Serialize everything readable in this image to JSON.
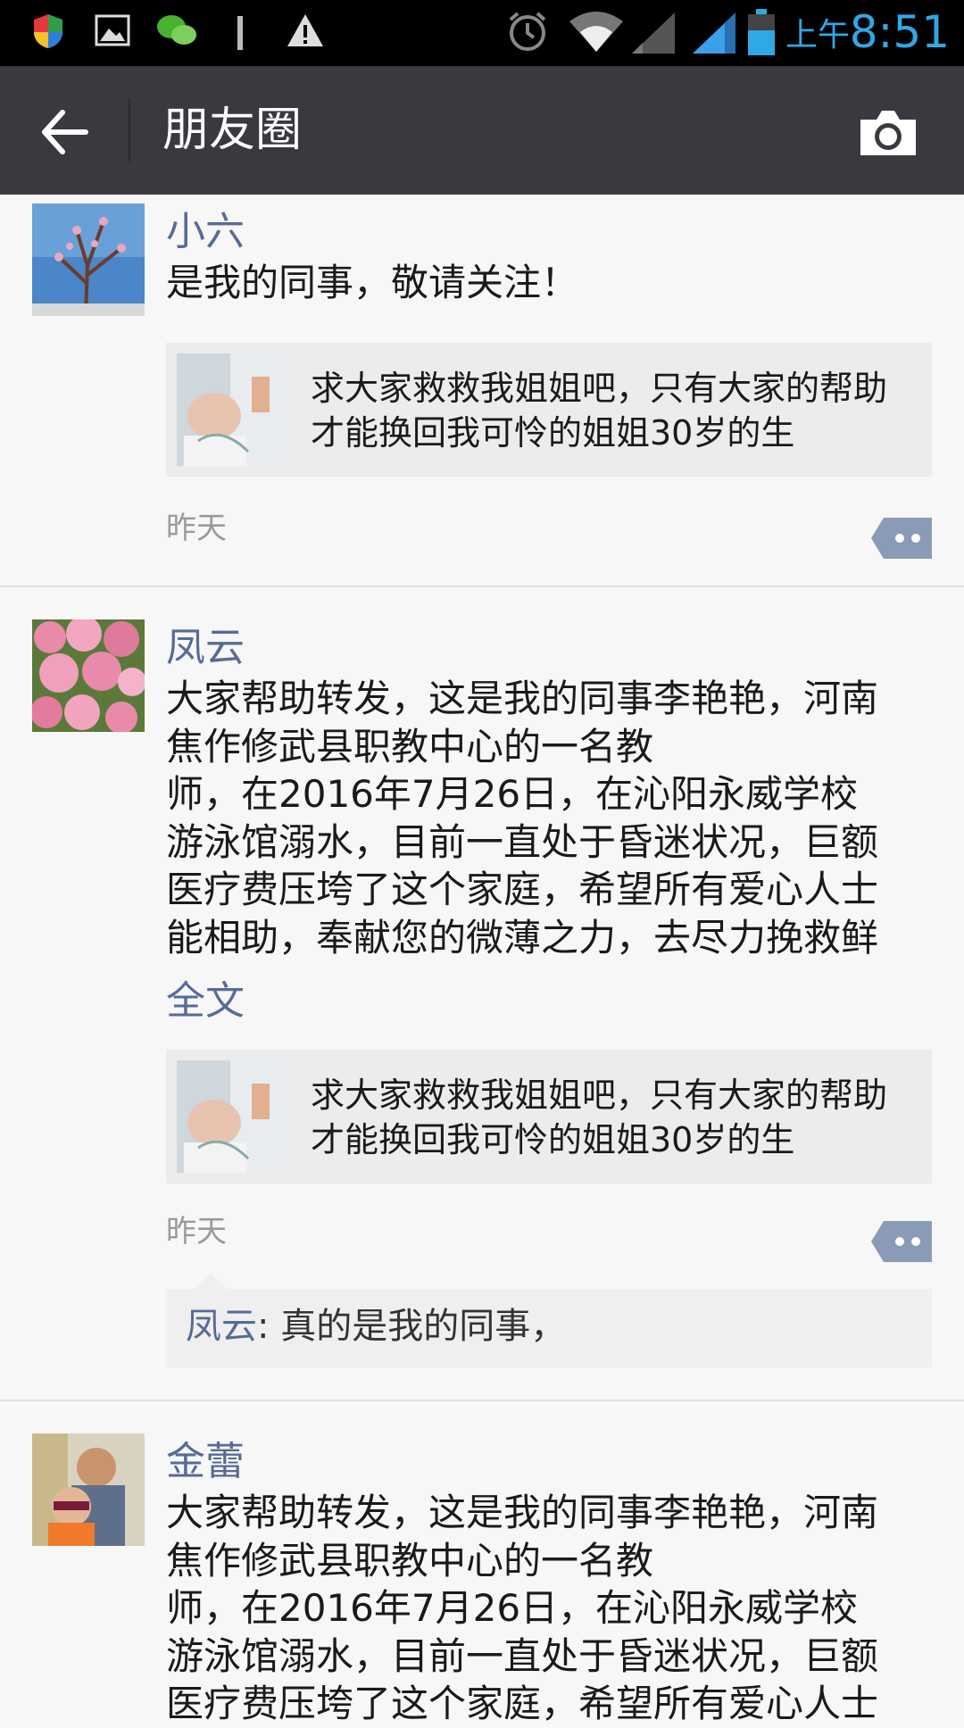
{
  "status_bar": {
    "ampm": "上午",
    "time": "8:51",
    "icons": [
      "shield-icon",
      "image-icon",
      "wechat-icon",
      "notification-bar-icon",
      "warning-icon",
      "alarm-icon",
      "wifi-icon",
      "signal-icon",
      "signal-icon",
      "battery-icon"
    ]
  },
  "nav": {
    "title": "朋友圈",
    "back_icon": "back-arrow-icon",
    "camera_icon": "camera-icon"
  },
  "posts": [
    {
      "name": "小六",
      "text": "是我的同事，敬请关注！",
      "share_text": "求大家救救我姐姐吧，只有大家的帮助才能换回我可怜的姐姐30岁的生",
      "time": "昨天"
    },
    {
      "name": "凤云",
      "text": "大家帮助转发，这是我的同事李艳艳，河南焦作修武县职教中心的一名教师，在2016年7月26日，在沁阳永威学校游泳馆溺水，目前一直处于昏迷状况，巨额医疗费压垮了这个家庭，希望所有爱心人士能相助，奉献您的微薄之力，去尽力挽救鲜",
      "text_lines": [
        "大家帮助转发，这是我的同事李艳艳，河南",
        "焦作修武县职教中心的一名教",
        "师，在2016年7月26日，在沁阳永威学校",
        "游泳馆溺水，目前一直处于昏迷状况，巨额",
        "医疗费压垮了这个家庭，希望所有爱心人士",
        "能相助，奉献您的微薄之力，去尽力挽救鲜"
      ],
      "full_text_link": "全文",
      "share_text": "求大家救救我姐姐吧，只有大家的帮助才能换回我可怜的姐姐30岁的生",
      "time": "昨天",
      "comment": {
        "author": "凤云",
        "separator": ": ",
        "text": "真的是我的同事，"
      }
    },
    {
      "name": "金蕾",
      "text_lines": [
        "大家帮助转发，这是我的同事李艳艳，河南",
        "焦作修武县职教中心的一名教",
        "师，在2016年7月26日，在沁阳永威学校",
        "游泳馆溺水，目前一直处于昏迷状况，巨额",
        "医疗费压垮了这个家庭，希望所有爱心人士"
      ]
    }
  ]
}
